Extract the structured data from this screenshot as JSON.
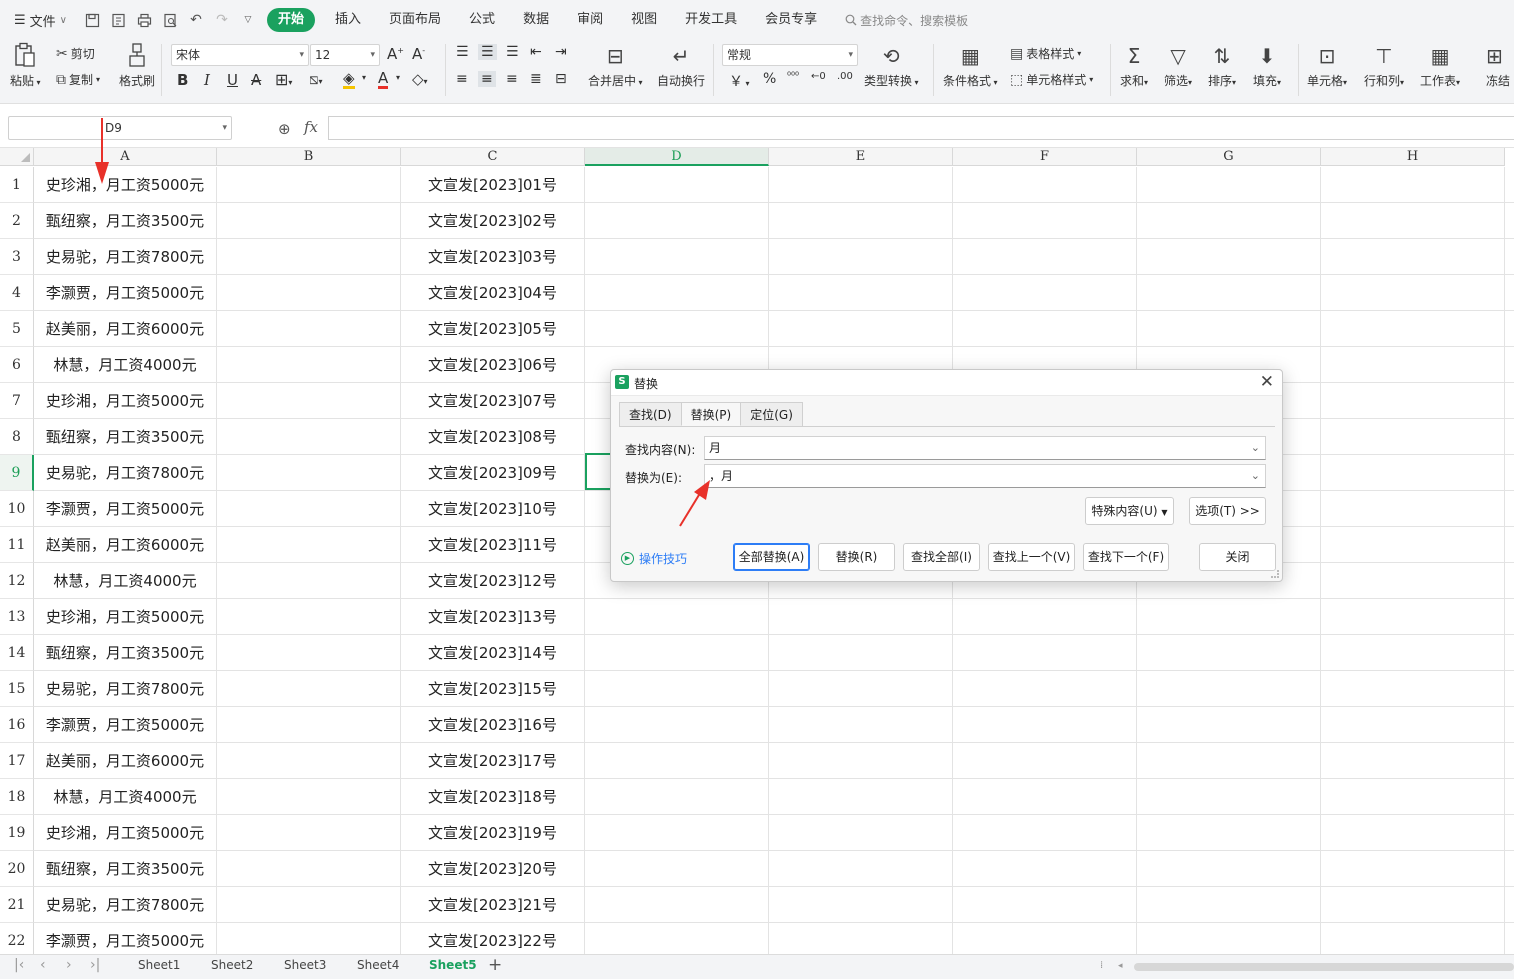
{
  "menubar": {
    "file_label": "文件",
    "tabs": [
      "开始",
      "插入",
      "页面布局",
      "公式",
      "数据",
      "审阅",
      "视图",
      "开发工具",
      "会员专享"
    ],
    "search_label": "查找命令、搜索模板"
  },
  "ribbon": {
    "paste": "粘贴",
    "cut": "剪切",
    "copy": "复制",
    "format_painter": "格式刷",
    "font_name": "宋体",
    "font_size": "12",
    "merge_center": "合并居中",
    "wrap": "自动换行",
    "number_format": "常规",
    "type_convert": "类型转换",
    "conditional_format": "条件格式",
    "table_style": "表格样式",
    "cell_style": "单元格样式",
    "sum": "求和",
    "filter": "筛选",
    "sort": "排序",
    "fill": "填充",
    "cell": "单元格",
    "row_col": "行和列",
    "worksheet": "工作表",
    "freeze": "冻结",
    "currency_symbol": "￥",
    "percent_symbol": "%"
  },
  "formula_bar": {
    "name_box": "D9",
    "fx": "fx",
    "content": ""
  },
  "grid": {
    "columns": [
      "A",
      "B",
      "C",
      "D",
      "E",
      "F",
      "G",
      "H"
    ],
    "selected_column": "D",
    "selected_row": "9",
    "rows": [
      {
        "num": "1",
        "a": "史珍湘，月工资5000元",
        "c": "文宣发[2023]01号"
      },
      {
        "num": "2",
        "a": "甄纽察，月工资3500元",
        "c": "文宣发[2023]02号"
      },
      {
        "num": "3",
        "a": "史易驼，月工资7800元",
        "c": "文宣发[2023]03号"
      },
      {
        "num": "4",
        "a": "李灏贾，月工资5000元",
        "c": "文宣发[2023]04号"
      },
      {
        "num": "5",
        "a": "赵美丽，月工资6000元",
        "c": "文宣发[2023]05号"
      },
      {
        "num": "6",
        "a": "林慧，月工资4000元",
        "c": "文宣发[2023]06号"
      },
      {
        "num": "7",
        "a": "史珍湘，月工资5000元",
        "c": "文宣发[2023]07号"
      },
      {
        "num": "8",
        "a": "甄纽察，月工资3500元",
        "c": "文宣发[2023]08号"
      },
      {
        "num": "9",
        "a": "史易驼，月工资7800元",
        "c": "文宣发[2023]09号"
      },
      {
        "num": "10",
        "a": "李灏贾，月工资5000元",
        "c": "文宣发[2023]10号"
      },
      {
        "num": "11",
        "a": "赵美丽，月工资6000元",
        "c": "文宣发[2023]11号"
      },
      {
        "num": "12",
        "a": "林慧，月工资4000元",
        "c": "文宣发[2023]12号"
      },
      {
        "num": "13",
        "a": "史珍湘，月工资5000元",
        "c": "文宣发[2023]13号"
      },
      {
        "num": "14",
        "a": "甄纽察，月工资3500元",
        "c": "文宣发[2023]14号"
      },
      {
        "num": "15",
        "a": "史易驼，月工资7800元",
        "c": "文宣发[2023]15号"
      },
      {
        "num": "16",
        "a": "李灏贾，月工资5000元",
        "c": "文宣发[2023]16号"
      },
      {
        "num": "17",
        "a": "赵美丽，月工资6000元",
        "c": "文宣发[2023]17号"
      },
      {
        "num": "18",
        "a": "林慧，月工资4000元",
        "c": "文宣发[2023]18号"
      },
      {
        "num": "19",
        "a": "史珍湘，月工资5000元",
        "c": "文宣发[2023]19号"
      },
      {
        "num": "20",
        "a": "甄纽察，月工资3500元",
        "c": "文宣发[2023]20号"
      },
      {
        "num": "21",
        "a": "史易驼，月工资7800元",
        "c": "文宣发[2023]21号"
      },
      {
        "num": "22",
        "a": "李灏贾，月工资5000元",
        "c": "文宣发[2023]22号"
      }
    ]
  },
  "sheets": {
    "tabs": [
      "Sheet1",
      "Sheet2",
      "Sheet3",
      "Sheet4",
      "Sheet5"
    ],
    "active": "Sheet5"
  },
  "dialog": {
    "title": "替换",
    "logo_letter": "S",
    "tabs": [
      "查找(D)",
      "替换(P)",
      "定位(G)"
    ],
    "active_tab": "替换(P)",
    "find_label": "查找内容(N):",
    "find_value": "月",
    "replace_label": "替换为(E):",
    "replace_value": "，月",
    "special_button": "特殊内容(U)",
    "options_button": "选项(T) >>",
    "tips_label": "操作技巧",
    "buttons": {
      "replace_all": "全部替换(A)",
      "replace": "替换(R)",
      "find_all": "查找全部(I)",
      "find_prev": "查找上一个(V)",
      "find_next": "查找下一个(F)",
      "close": "关闭"
    }
  },
  "colors": {
    "accent": "#1aa15f",
    "link": "#2d7df6",
    "annotation": "#e8312a"
  }
}
